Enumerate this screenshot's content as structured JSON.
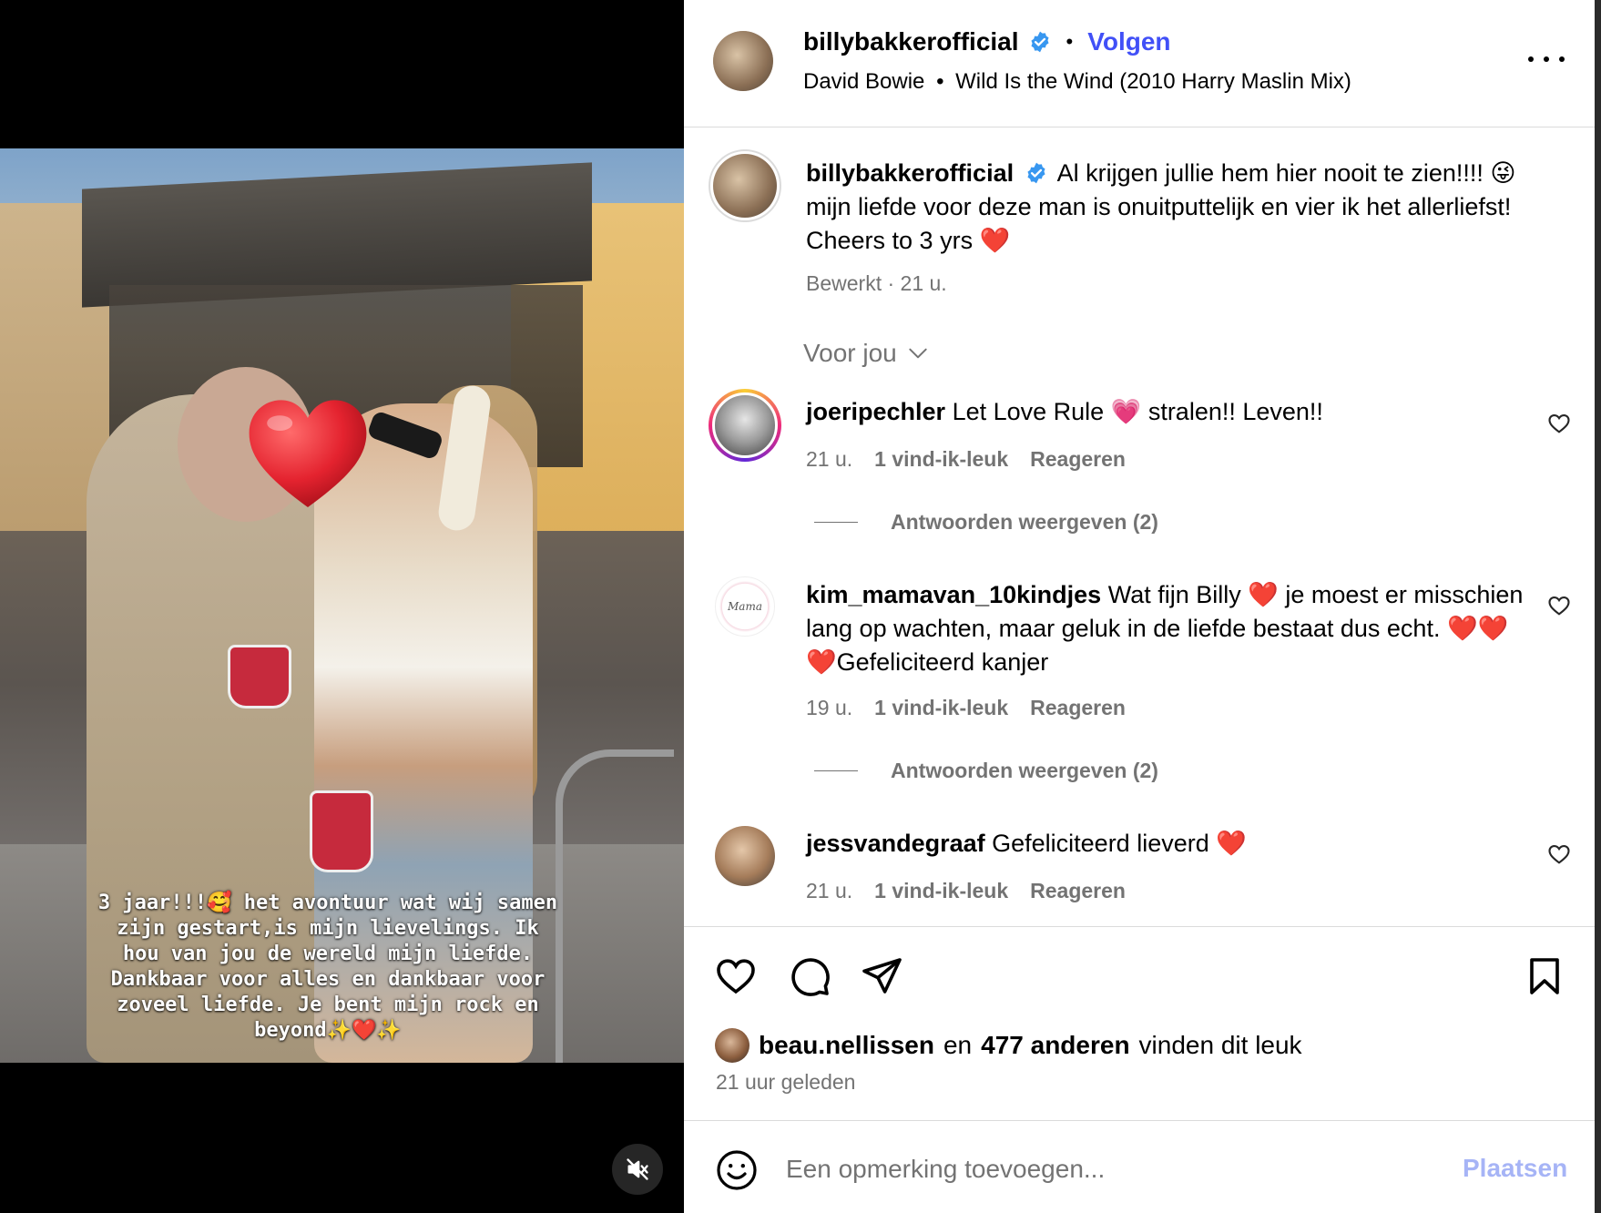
{
  "media": {
    "story_overlay_lines": [
      "3 jaar!!!🥰 het avontuur wat wij samen",
      "zijn gestart,is mijn lievelings. Ik",
      "hou van jou de wereld mijn liefde.",
      "Dankbaar voor alles en dankbaar voor",
      "zoveel liefde. Je bent mijn rock en",
      "beyond✨❤️✨"
    ],
    "mute_icon": "speaker-muted-icon"
  },
  "header": {
    "username": "billybakkerofficial",
    "separator": "•",
    "follow_label": "Volgen",
    "audio_artist": "David Bowie",
    "audio_separator": "•",
    "audio_track": "Wild Is the Wind (2010 Harry Maslin Mix)",
    "more_icon": "more-options-icon"
  },
  "caption": {
    "username": "billybakkerofficial",
    "text": "Al krijgen jullie hem hier nooit te zien!!!! 😜 mijn liefde voor deze man is onuitputtelijk en vier ik het allerliefst! Cheers to 3 yrs ❤️",
    "edited": "Bewerkt",
    "dot": "·",
    "time": "21 u."
  },
  "sort": {
    "label": "Voor jou",
    "icon": "chevron-down-icon"
  },
  "comments": [
    {
      "username": "joeripechler",
      "text": "Let Love Rule 💗 stralen!! Leven!!",
      "time": "21 u.",
      "likes": "1 vind-ik-leuk",
      "reply": "Reageren",
      "replies": "Antwoorden weergeven (2)"
    },
    {
      "username": "kim_mamavan_10kindjes",
      "text": "Wat fijn Billy ❤️ je moest er misschien lang op wachten, maar geluk in de liefde bestaat dus echt. ❤️❤️❤️Gefeliciteerd kanjer",
      "time": "19 u.",
      "likes": "1 vind-ik-leuk",
      "reply": "Reageren",
      "replies": "Antwoorden weergeven (2)",
      "avatar_text": "Mama"
    },
    {
      "username": "jessvandegraaf",
      "text": "Gefeliciteerd lieverd ❤️",
      "time": "21 u.",
      "likes": "1 vind-ik-leuk",
      "reply": "Reageren"
    }
  ],
  "likes": {
    "first_user": "beau.nellissen",
    "connector": "en",
    "others": "477 anderen",
    "suffix": "vinden dit leuk"
  },
  "posted": "21 uur geleden",
  "composer": {
    "placeholder": "Een opmerking toevoegen...",
    "post_label": "Plaatsen",
    "emoji_icon": "emoji-icon"
  },
  "colors": {
    "link_blue": "#4150f7",
    "muted_text": "#737373",
    "post_disabled": "#a6b4f6",
    "verified": "#3897f0",
    "heart_red": "#e4232f"
  }
}
